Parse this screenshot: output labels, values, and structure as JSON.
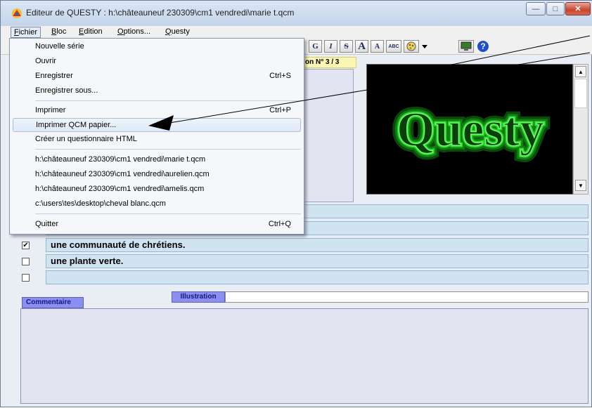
{
  "window": {
    "title": "Editeur de QUESTY : h:\\châteauneuf 230309\\cm1 vendredi\\marie t.qcm",
    "minimize_glyph": "—",
    "maximize_glyph": "□",
    "close_glyph": "✕"
  },
  "menubar": {
    "items": [
      {
        "accel": "F",
        "rest": "ichier"
      },
      {
        "accel": "B",
        "rest": "loc"
      },
      {
        "accel": "E",
        "rest": "dition"
      },
      {
        "accel": "O",
        "rest": "ptions..."
      },
      {
        "accel": "Q",
        "rest": "uesty"
      }
    ]
  },
  "toolbar": {
    "bold": "G",
    "italic": "I",
    "strike": "S",
    "font_larger": "A",
    "font_smaller": "A",
    "spell": "ABC",
    "icons": [
      "paint-icon",
      "dropdown-arrow-icon",
      "screen-icon",
      "help-icon"
    ]
  },
  "question": {
    "number_label": "on N° 3 / 3"
  },
  "image_panel": {
    "logo_text": "Questy"
  },
  "answers": [
    {
      "checked": false,
      "text": ""
    },
    {
      "checked": false,
      "text": ""
    },
    {
      "checked": true,
      "text": "une communauté de chrétiens."
    },
    {
      "checked": false,
      "text": "une plante verte."
    },
    {
      "checked": false,
      "text": ""
    }
  ],
  "check_glyph": "✔",
  "comment": {
    "tab_label": "Commentaire",
    "illustration_label": "Illustration"
  },
  "file_menu": {
    "items": [
      {
        "label": "Nouvelle série",
        "shortcut": ""
      },
      {
        "label": "Ouvrir",
        "shortcut": ""
      },
      {
        "label": "Enregistrer",
        "shortcut": "Ctrl+S"
      },
      {
        "label": "Enregistrer sous...",
        "shortcut": ""
      },
      {
        "label": "Imprimer",
        "shortcut": "Ctrl+P"
      },
      {
        "label": "Imprimer QCM papier...",
        "shortcut": ""
      },
      {
        "label": "Créer un questionnaire HTML",
        "shortcut": ""
      },
      {
        "label": "h:\\châteauneuf 230309\\cm1 vendredi\\marie t.qcm",
        "shortcut": ""
      },
      {
        "label": "h:\\châteauneuf 230309\\cm1 vendredi\\aurelien.qcm",
        "shortcut": ""
      },
      {
        "label": "h:\\châteauneuf 230309\\cm1 vendredi\\amelis.qcm",
        "shortcut": ""
      },
      {
        "label": "c:\\users\\tes\\desktop\\cheval blanc.qcm",
        "shortcut": ""
      },
      {
        "label": "Quitter",
        "shortcut": "Ctrl+Q"
      }
    ]
  },
  "colors": {
    "accent": "#8d8ef2",
    "answer_bg": "#cfe3f0",
    "question_bg": "#e3e4f2",
    "logo_green": "#2bd62b"
  }
}
